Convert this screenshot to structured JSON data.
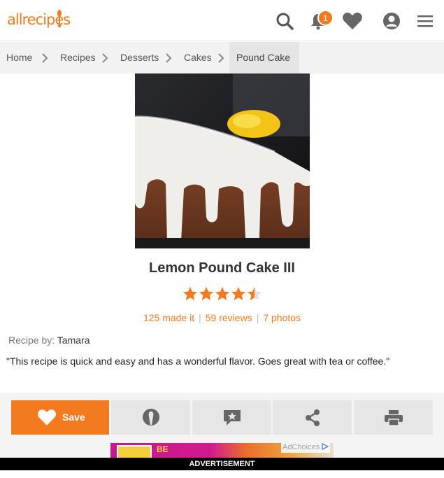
{
  "brand": {
    "logo_text": "allrecipes",
    "accent_color": "#f47a20"
  },
  "header": {
    "icons": [
      "search-icon",
      "bell-icon",
      "heart-icon",
      "profile-icon",
      "menu-icon"
    ],
    "notification_count": "1"
  },
  "breadcrumb": {
    "items": [
      "Home",
      "Recipes",
      "Desserts",
      "Cakes",
      "Pound Cake"
    ]
  },
  "recipe": {
    "title": "Lemon Pound Cake III",
    "rating": 4.5,
    "rating_max": 5,
    "made_it": "125 made it",
    "reviews": "59 reviews",
    "photos": "7 photos",
    "by_label": "Recipe by:",
    "author": "Tamara",
    "description": "\"This recipe is quick and easy and has a wonderful flavor. Goes great with tea or coffee.\""
  },
  "actions": {
    "save_label": "Save",
    "buttons": [
      "made-it-icon",
      "review-icon",
      "share-icon",
      "print-icon"
    ]
  },
  "ad": {
    "partial_text": "BE",
    "adchoices_label": "AdChoices",
    "advertisement_label": "ADVERTISEMENT"
  }
}
